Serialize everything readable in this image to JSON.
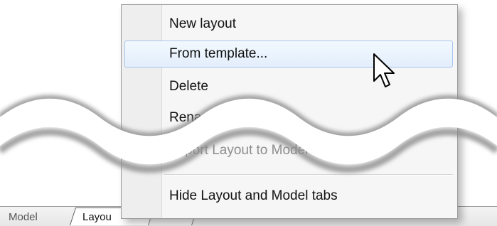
{
  "tabs": {
    "model": "Model",
    "layout": "Layou"
  },
  "context_menu": {
    "items": [
      {
        "label": "New layout",
        "state": "normal"
      },
      {
        "label": "From template...",
        "state": "hover"
      },
      {
        "label": "Delete",
        "state": "normal"
      },
      {
        "label": "Rename",
        "state": "obscured"
      },
      {
        "label": "Export Layout to Model",
        "state": "disabled"
      },
      {
        "label": "Hide Layout and Model tabs",
        "state": "normal"
      }
    ]
  },
  "icons": {
    "cursor": "mouse-pointer-icon"
  }
}
